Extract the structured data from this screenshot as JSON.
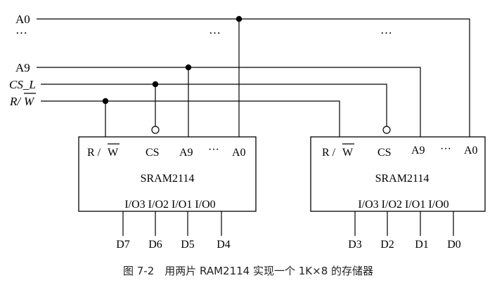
{
  "signals": {
    "a0": "A0",
    "ellipsis": "…",
    "a9": "A9",
    "cs": "CS_L",
    "rw_r": "R/",
    "rw_w": "W"
  },
  "chips": {
    "left": {
      "name": "SRAM2114",
      "pins_top": {
        "rw_r": "R / ",
        "rw_w": "W",
        "cs": "CS",
        "a9": "A9",
        "dots": "···",
        "a0": "A0"
      },
      "io": "I/O3 I/O2 I/O1 I/O0",
      "data": [
        "D7",
        "D6",
        "D5",
        "D4"
      ]
    },
    "right": {
      "name": "SRAM2114",
      "pins_top": {
        "rw_r": "R / ",
        "rw_w": "W",
        "cs": "CS",
        "a9": "A9",
        "dots": "···",
        "a0": "A0"
      },
      "io": "I/O3 I/O2 I/O1 I/O0",
      "data": [
        "D3",
        "D2",
        "D1",
        "D0"
      ]
    }
  },
  "caption": "图 7-2　用两片 RAM2114 实现一个 1K×8 的存储器"
}
